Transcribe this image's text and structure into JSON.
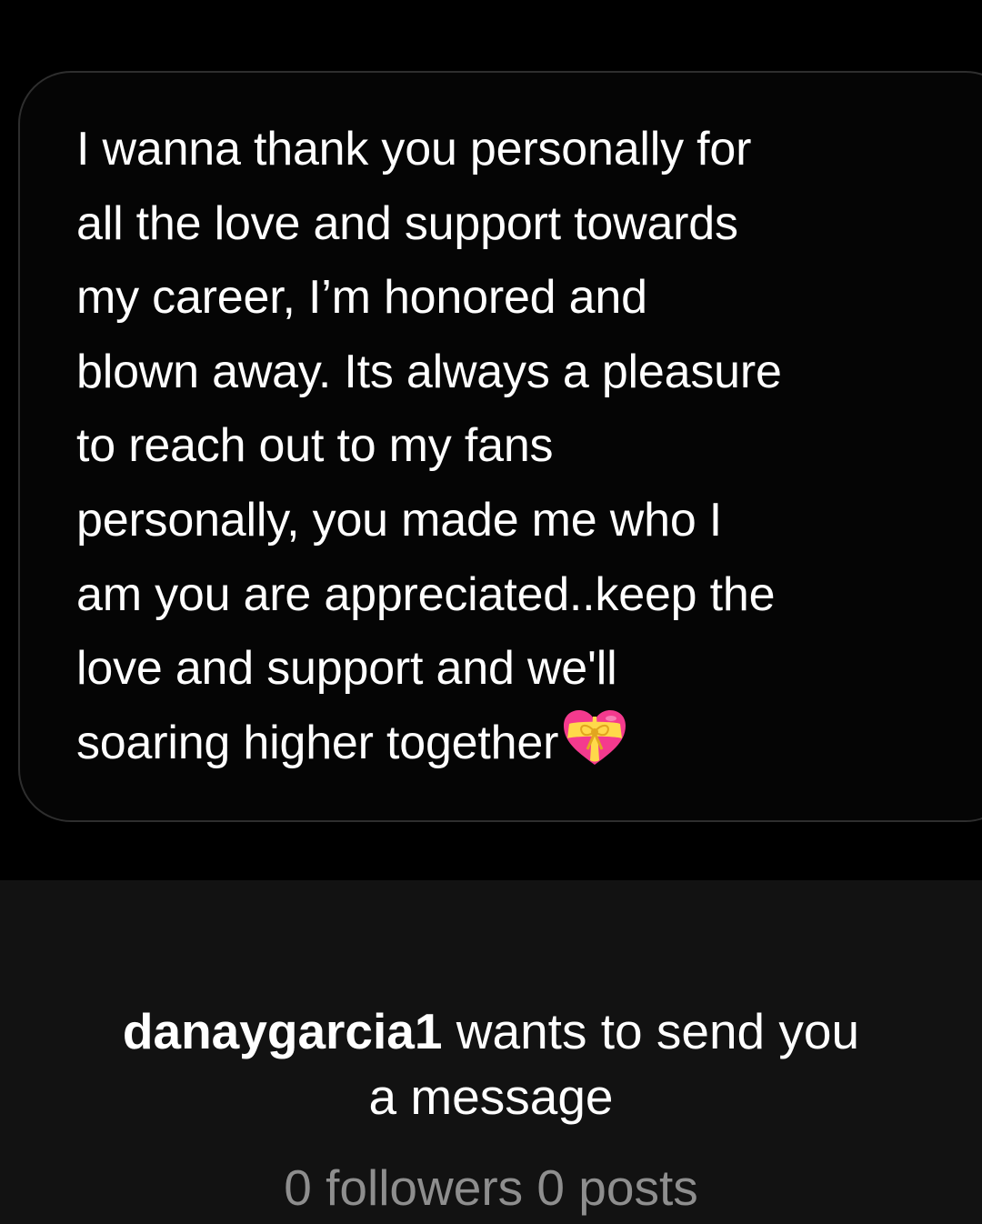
{
  "message": {
    "lines": [
      "I wanna thank you personally for",
      "all the love and support towards",
      "my career, I’m honored and",
      "blown away. Its always a pleasure",
      "to reach out to my fans",
      "personally, you made me who I",
      "am you are appreciated..keep the",
      "love and support and we'll",
      "soaring higher together"
    ],
    "emoji": "heart-with-ribbon-emoji"
  },
  "request": {
    "username": "danaygarcia1",
    "text_after_username": " wants to send you",
    "second_line": "a message"
  },
  "profile_stats": {
    "followers_count": "0",
    "followers_label": "followers",
    "posts_count": "0",
    "posts_label": "posts"
  },
  "colors": {
    "background": "#000000",
    "panel": "#121212",
    "bubble_border": "#2e2e2e",
    "primary_text": "#ffffff",
    "secondary_text": "#8e8e8e",
    "heart_pink": "#f43a8e",
    "ribbon_yellow": "#ffd94a"
  }
}
